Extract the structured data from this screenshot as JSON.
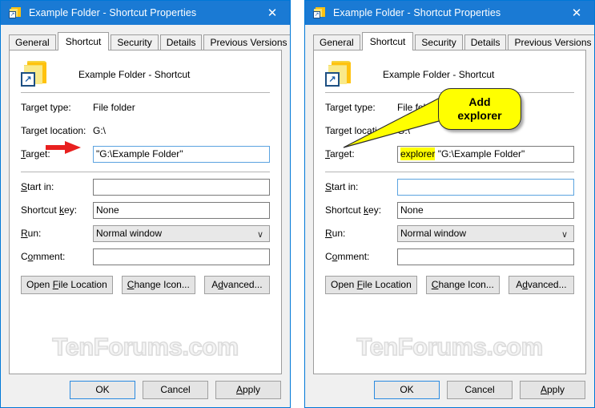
{
  "window": {
    "title": "Example Folder - Shortcut Properties",
    "close_label": "✕",
    "icon": "folder-shortcut-icon"
  },
  "tabs": [
    {
      "label": "General",
      "active": false
    },
    {
      "label": "Shortcut",
      "active": true
    },
    {
      "label": "Security",
      "active": false
    },
    {
      "label": "Details",
      "active": false
    },
    {
      "label": "Previous Versions",
      "active": false
    }
  ],
  "shortcut": {
    "header_title": "Example Folder - Shortcut",
    "target_type_label": "Target type:",
    "target_type_value": "File folder",
    "target_location_label": "Target location:",
    "target_location_value": "G:\\",
    "target_label": "Target:",
    "target_value_left": "\"G:\\Example Folder\"",
    "target_value_right_highlight": "explorer",
    "target_value_right_rest": " \"G:\\Example Folder\"",
    "start_in_label": "Start in:",
    "start_in_value": "",
    "shortcut_key_label": "Shortcut key:",
    "shortcut_key_value": "None",
    "run_label": "Run:",
    "run_value": "Normal window",
    "run_chevron": "∨",
    "comment_label": "Comment:",
    "comment_value": "",
    "open_file_location_button": "Open File Location",
    "change_icon_button": "Change Icon...",
    "advanced_button": "Advanced..."
  },
  "dialog_buttons": {
    "ok": "OK",
    "cancel": "Cancel",
    "apply": "Apply"
  },
  "callout": {
    "line1": "Add",
    "line2": "explorer",
    "bg_color": "#ffff00",
    "border_color": "#2b2b2b"
  },
  "annotation": {
    "arrow_color": "#e8201f",
    "arrow_name": "red-arrow-pointing-to-target-field"
  },
  "watermark": {
    "text": "TenForums.com"
  },
  "colors": {
    "titlebar": "#1a7ad4",
    "window_border": "#0078d7",
    "dialog_face": "#f0f0f0",
    "focus_border": "#5ba3e0",
    "highlight": "#ffff00"
  }
}
